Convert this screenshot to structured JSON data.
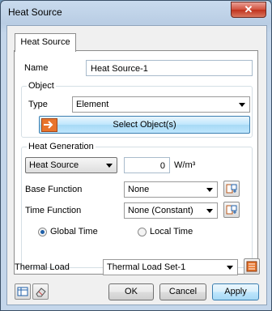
{
  "window": {
    "title": "Heat Source",
    "close_glyph": "✕"
  },
  "tab": {
    "label": "Heat Source"
  },
  "name": {
    "label": "Name",
    "value": "Heat Source-1"
  },
  "object_group": {
    "title": "Object",
    "type_label": "Type",
    "type_value": "Element",
    "select_button": "Select Object(s)"
  },
  "heat_generation": {
    "title": "Heat Generation",
    "kind_value": "Heat Source",
    "amount_value": "0",
    "unit": "W/m³",
    "base_function_label": "Base Function",
    "base_function_value": "None",
    "time_function_label": "Time Function",
    "time_function_value": "None (Constant)",
    "global_time_label": "Global Time",
    "local_time_label": "Local Time",
    "selected_time": "Global Time"
  },
  "thermal_load": {
    "label": "Thermal Load",
    "value": "Thermal Load Set-1"
  },
  "buttons": {
    "ok": "OK",
    "cancel": "Cancel",
    "apply": "Apply"
  },
  "colors": {
    "accent": "#3c7fb1",
    "close": "#c0311c",
    "select_icon": "#e8742b"
  }
}
